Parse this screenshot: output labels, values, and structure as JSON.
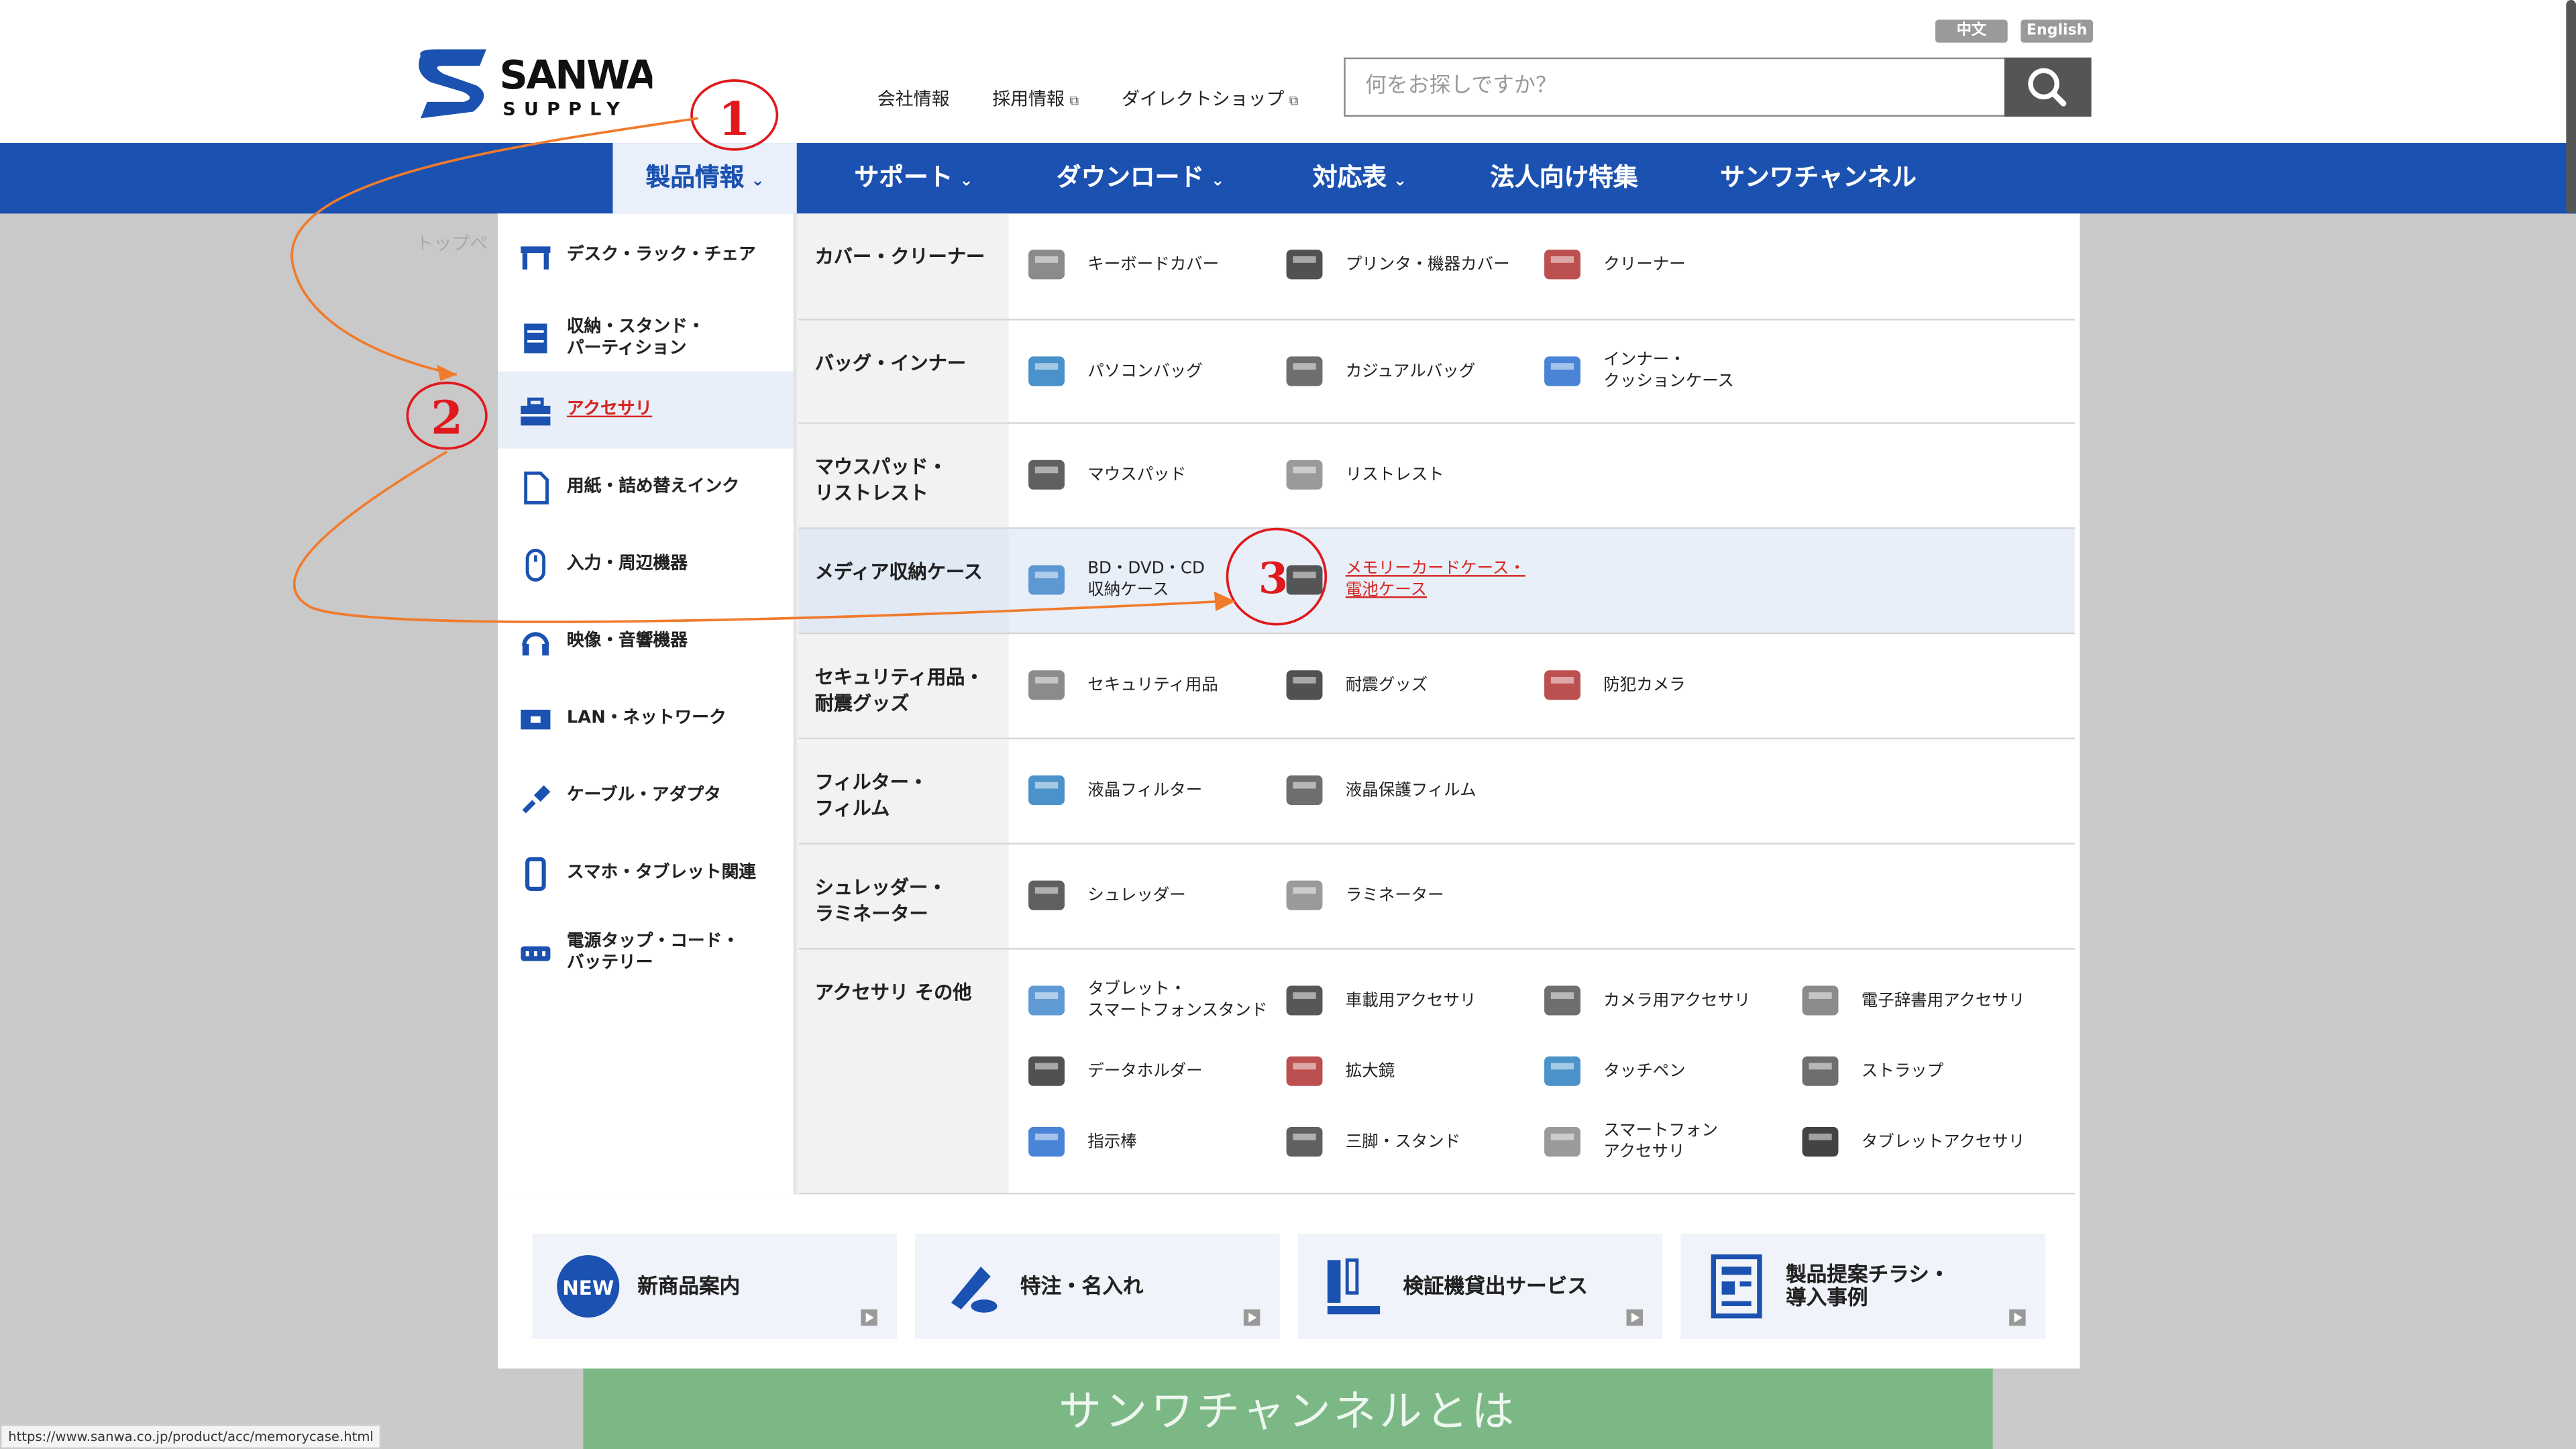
{
  "header": {
    "brand_icon": "sanwa-supply-logo",
    "lang_zh": "中文",
    "lang_en": "English",
    "links": [
      "会社情報",
      "採用情報",
      "ダイレクトショップ"
    ],
    "search_placeholder": "何をお探しですか？",
    "search_icon": "search-icon"
  },
  "nav": {
    "items": [
      "製品情報",
      "サポート",
      "ダウンロード",
      "対応表",
      "法人向け特集",
      "サンワチャンネル"
    ]
  },
  "breadcrumb": "トップペ",
  "sidebar": {
    "items": [
      {
        "label": "デスク・ラック・チェア",
        "icon": "desk-icon"
      },
      {
        "label": "収納・スタンド・\nパーティション",
        "icon": "cabinet-icon"
      },
      {
        "label": "アクセサリ",
        "icon": "toolbox-icon"
      },
      {
        "label": "用紙・詰め替えインク",
        "icon": "paper-icon"
      },
      {
        "label": "入力・周辺機器",
        "icon": "mouse-icon"
      },
      {
        "label": "映像・音響機器",
        "icon": "headset-icon"
      },
      {
        "label": "LAN・ネットワーク",
        "icon": "network-icon"
      },
      {
        "label": "ケーブル・アダプタ",
        "icon": "cable-icon"
      },
      {
        "label": "スマホ・タブレット関連",
        "icon": "smartphone-icon"
      },
      {
        "label": "電源タップ・コード・\nバッテリー",
        "icon": "power-strip-icon"
      }
    ]
  },
  "categories": [
    {
      "title": "カバー・クリーナー",
      "products": [
        "キーボードカバー",
        "プリンタ・機器カバー",
        "クリーナー"
      ]
    },
    {
      "title": "バッグ・インナー",
      "products": [
        "パソコンバッグ",
        "カジュアルバッグ",
        "インナー・\nクッションケース"
      ]
    },
    {
      "title": "マウスパッド・\nリストレスト",
      "products": [
        "マウスパッド",
        "リストレスト"
      ]
    },
    {
      "title": "メディア収納ケース",
      "products": [
        "BD・DVD・CD\n収納ケース",
        "メモリーカードケース・\n電池ケース"
      ]
    },
    {
      "title": "セキュリティ用品・\n耐震グッズ",
      "products": [
        "セキュリティ用品",
        "耐震グッズ",
        "防犯カメラ"
      ]
    },
    {
      "title": "フィルター・\nフィルム",
      "products": [
        "液晶フィルター",
        "液晶保護フィルム"
      ]
    },
    {
      "title": "シュレッダー・\nラミネーター",
      "products": [
        "シュレッダー",
        "ラミネーター"
      ]
    },
    {
      "title": "アクセサリ その他",
      "products": [
        "タブレット・\nスマートフォンスタンド",
        "車載用アクセサリ",
        "カメラ用アクセサリ",
        "電子辞書用アクセサリ",
        "データホルダー",
        "拡大鏡",
        "タッチペン",
        "ストラップ",
        "指示棒",
        "三脚・スタンド",
        "スマートフォン\nアクセサリ",
        "タブレットアクセサリ"
      ]
    }
  ],
  "banners": [
    "新商品案内",
    "特注・名入れ",
    "検証機貸出サービス",
    "製品提案チラシ・\n導入事例"
  ],
  "banner_new_badge": "NEW",
  "green_banner": "サンワチャンネルとは",
  "status_url": "https://www.sanwa.co.jp/product/acc/memorycase.html",
  "annotations": [
    "1",
    "2",
    "3"
  ],
  "colors": {
    "nav": "#1b51b0",
    "accent_red": "#d6251f",
    "annotation_orange": "#f07b2c"
  }
}
